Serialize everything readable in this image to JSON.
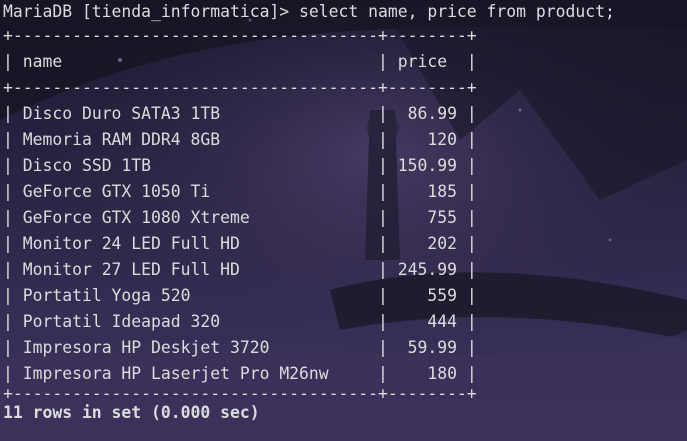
{
  "terminal": {
    "prompt": "MariaDB [tienda_informatica]> ",
    "command": "select name, price from product;",
    "border": "+-------------------------------------+--------+",
    "headers": [
      "name",
      "price"
    ],
    "rows": [
      [
        "Disco Duro SATA3 1TB",
        "86.99"
      ],
      [
        "Memoria RAM DDR4 8GB",
        "120"
      ],
      [
        "Disco SSD 1TB",
        "150.99"
      ],
      [
        "GeForce GTX 1050 Ti",
        "185"
      ],
      [
        "GeForce GTX 1080 Xtreme",
        "755"
      ],
      [
        "Monitor 24 LED Full HD",
        "202"
      ],
      [
        "Monitor 27 LED Full HD",
        "245.99"
      ],
      [
        "Portatil Yoga 520",
        "559"
      ],
      [
        "Portatil Ideapad 320",
        "444"
      ],
      [
        "Impresora HP Deskjet 3720",
        "59.99"
      ],
      [
        "Impresora HP Laserjet Pro M26nw",
        "180"
      ]
    ],
    "summary": "11 rows in set (0.000 sec)"
  },
  "colors": {
    "text": "#dcdcdc",
    "background": "#2a2440"
  }
}
